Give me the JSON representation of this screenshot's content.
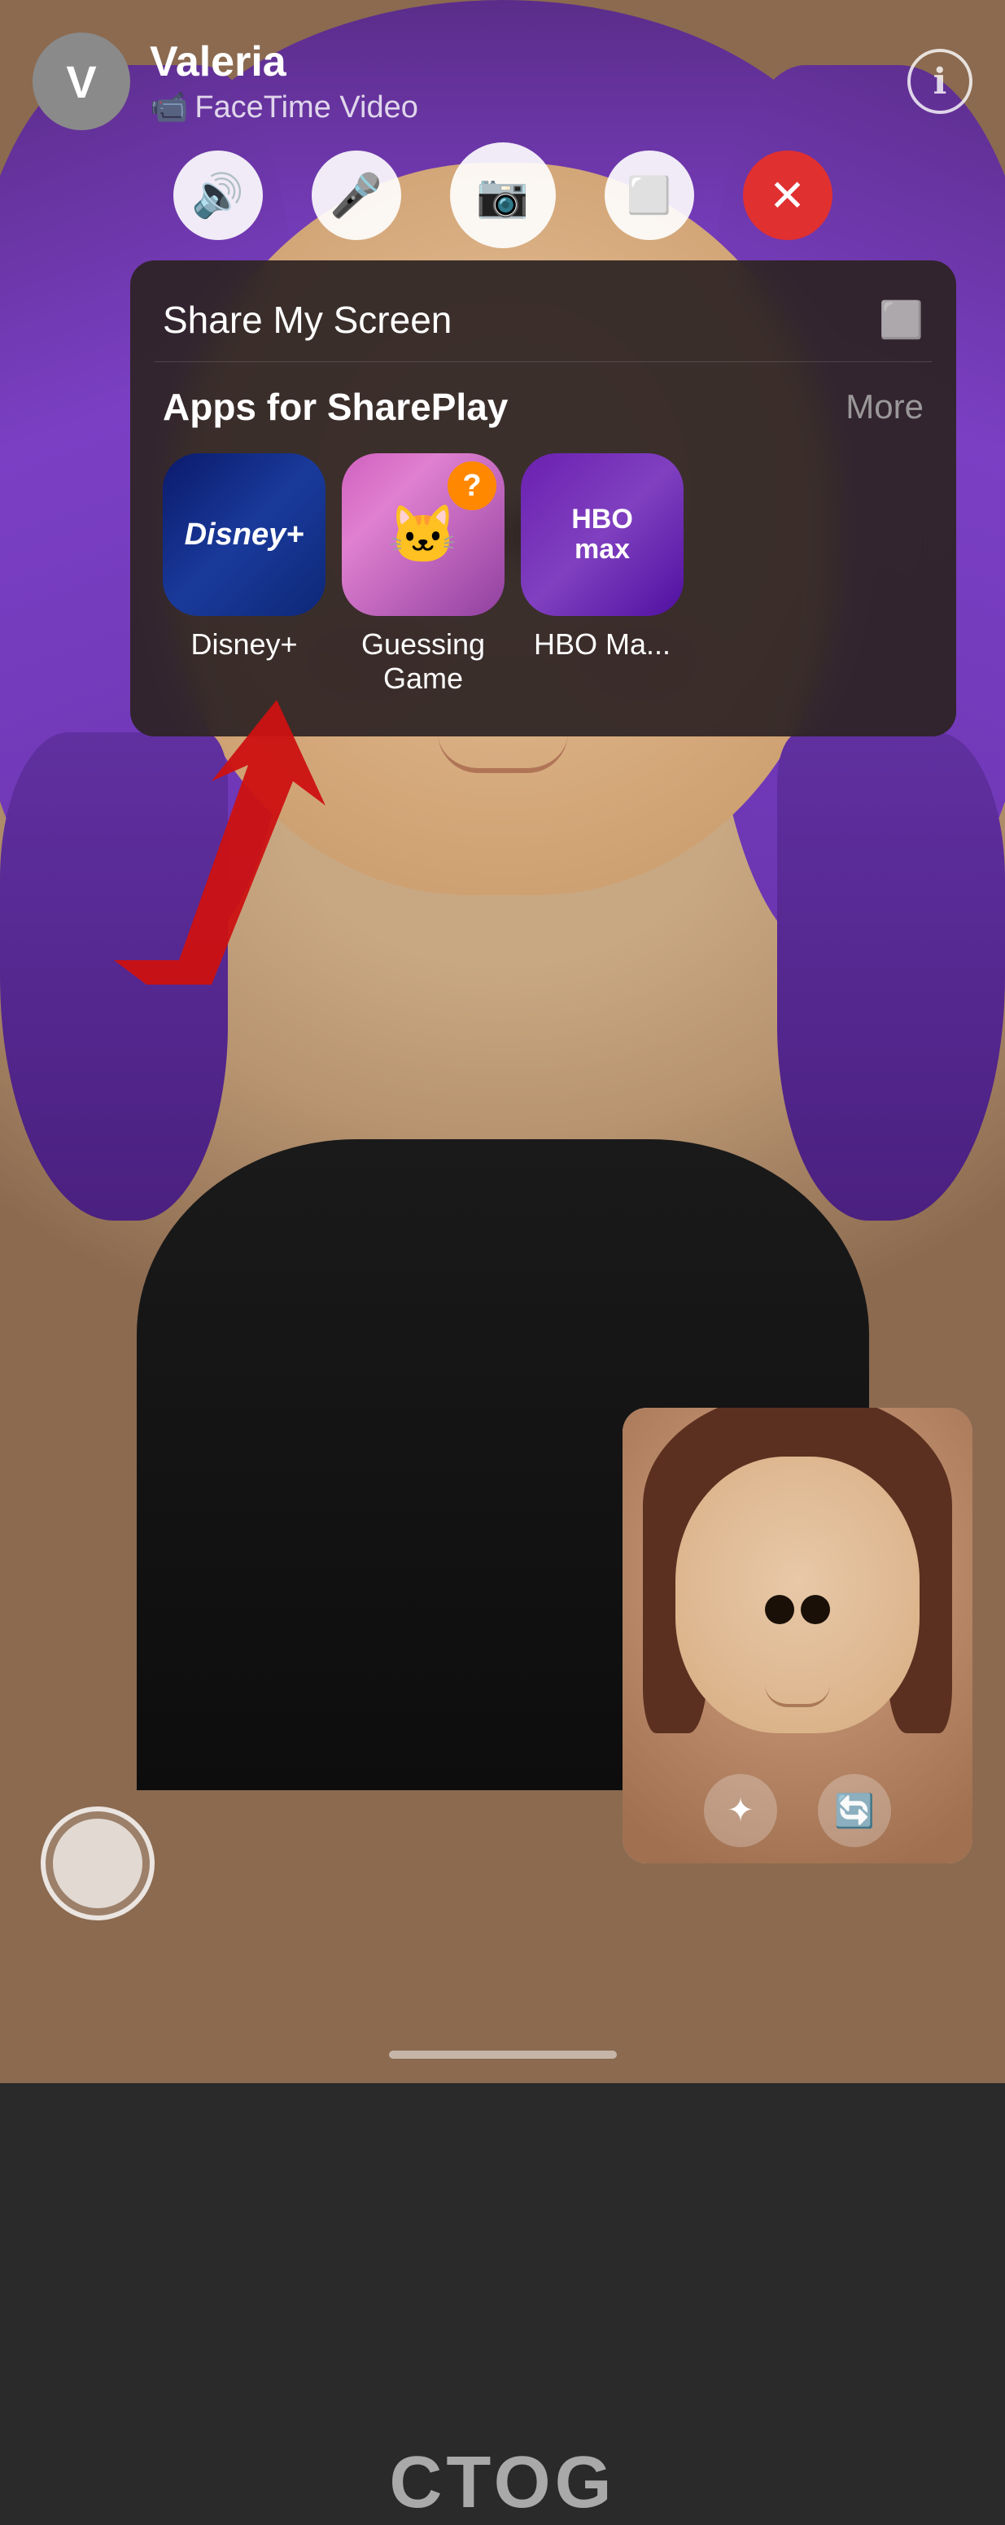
{
  "topBar": {
    "callerInitial": "V",
    "callerName": "Valeria",
    "callerStatus": "FaceTime Video",
    "infoIcon": "ℹ"
  },
  "controls": {
    "speakerLabel": "speaker",
    "micLabel": "microphone",
    "cameraLabel": "camera",
    "shareLabel": "shareplay",
    "endLabel": "end call"
  },
  "sharePlayPopup": {
    "shareScreenText": "Share My Screen",
    "appsTitle": "Apps for SharePlay",
    "moreLabel": "More",
    "apps": [
      {
        "id": "disney",
        "label": "Disney+"
      },
      {
        "id": "guessing",
        "label": "Guessing\nGame"
      },
      {
        "id": "hbo",
        "label": "HBO Ma..."
      }
    ]
  },
  "secondaryCall": {
    "effectsLabel": "effects",
    "flipLabel": "flip camera"
  },
  "arrowAlt": "pointing to Guessing Game app",
  "shirtText": "CTOG",
  "homeIndicator": "home indicator"
}
